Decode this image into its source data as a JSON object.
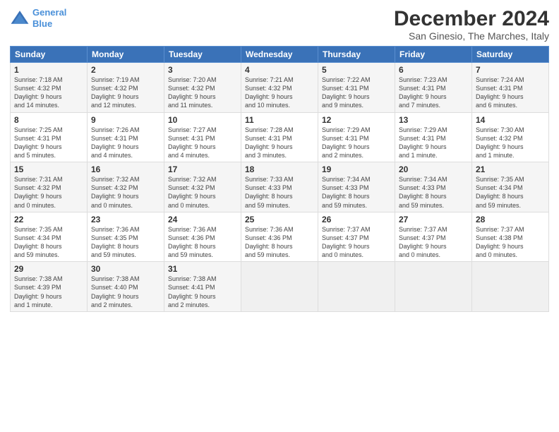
{
  "header": {
    "logo_line1": "General",
    "logo_line2": "Blue",
    "title": "December 2024",
    "subtitle": "San Ginesio, The Marches, Italy"
  },
  "weekdays": [
    "Sunday",
    "Monday",
    "Tuesday",
    "Wednesday",
    "Thursday",
    "Friday",
    "Saturday"
  ],
  "weeks": [
    [
      {
        "day": "1",
        "info": "Sunrise: 7:18 AM\nSunset: 4:32 PM\nDaylight: 9 hours\nand 14 minutes."
      },
      {
        "day": "2",
        "info": "Sunrise: 7:19 AM\nSunset: 4:32 PM\nDaylight: 9 hours\nand 12 minutes."
      },
      {
        "day": "3",
        "info": "Sunrise: 7:20 AM\nSunset: 4:32 PM\nDaylight: 9 hours\nand 11 minutes."
      },
      {
        "day": "4",
        "info": "Sunrise: 7:21 AM\nSunset: 4:32 PM\nDaylight: 9 hours\nand 10 minutes."
      },
      {
        "day": "5",
        "info": "Sunrise: 7:22 AM\nSunset: 4:31 PM\nDaylight: 9 hours\nand 9 minutes."
      },
      {
        "day": "6",
        "info": "Sunrise: 7:23 AM\nSunset: 4:31 PM\nDaylight: 9 hours\nand 7 minutes."
      },
      {
        "day": "7",
        "info": "Sunrise: 7:24 AM\nSunset: 4:31 PM\nDaylight: 9 hours\nand 6 minutes."
      }
    ],
    [
      {
        "day": "8",
        "info": "Sunrise: 7:25 AM\nSunset: 4:31 PM\nDaylight: 9 hours\nand 5 minutes."
      },
      {
        "day": "9",
        "info": "Sunrise: 7:26 AM\nSunset: 4:31 PM\nDaylight: 9 hours\nand 4 minutes."
      },
      {
        "day": "10",
        "info": "Sunrise: 7:27 AM\nSunset: 4:31 PM\nDaylight: 9 hours\nand 4 minutes."
      },
      {
        "day": "11",
        "info": "Sunrise: 7:28 AM\nSunset: 4:31 PM\nDaylight: 9 hours\nand 3 minutes."
      },
      {
        "day": "12",
        "info": "Sunrise: 7:29 AM\nSunset: 4:31 PM\nDaylight: 9 hours\nand 2 minutes."
      },
      {
        "day": "13",
        "info": "Sunrise: 7:29 AM\nSunset: 4:31 PM\nDaylight: 9 hours\nand 1 minute."
      },
      {
        "day": "14",
        "info": "Sunrise: 7:30 AM\nSunset: 4:32 PM\nDaylight: 9 hours\nand 1 minute."
      }
    ],
    [
      {
        "day": "15",
        "info": "Sunrise: 7:31 AM\nSunset: 4:32 PM\nDaylight: 9 hours\nand 0 minutes."
      },
      {
        "day": "16",
        "info": "Sunrise: 7:32 AM\nSunset: 4:32 PM\nDaylight: 9 hours\nand 0 minutes."
      },
      {
        "day": "17",
        "info": "Sunrise: 7:32 AM\nSunset: 4:32 PM\nDaylight: 9 hours\nand 0 minutes."
      },
      {
        "day": "18",
        "info": "Sunrise: 7:33 AM\nSunset: 4:33 PM\nDaylight: 8 hours\nand 59 minutes."
      },
      {
        "day": "19",
        "info": "Sunrise: 7:34 AM\nSunset: 4:33 PM\nDaylight: 8 hours\nand 59 minutes."
      },
      {
        "day": "20",
        "info": "Sunrise: 7:34 AM\nSunset: 4:33 PM\nDaylight: 8 hours\nand 59 minutes."
      },
      {
        "day": "21",
        "info": "Sunrise: 7:35 AM\nSunset: 4:34 PM\nDaylight: 8 hours\nand 59 minutes."
      }
    ],
    [
      {
        "day": "22",
        "info": "Sunrise: 7:35 AM\nSunset: 4:34 PM\nDaylight: 8 hours\nand 59 minutes."
      },
      {
        "day": "23",
        "info": "Sunrise: 7:36 AM\nSunset: 4:35 PM\nDaylight: 8 hours\nand 59 minutes."
      },
      {
        "day": "24",
        "info": "Sunrise: 7:36 AM\nSunset: 4:36 PM\nDaylight: 8 hours\nand 59 minutes."
      },
      {
        "day": "25",
        "info": "Sunrise: 7:36 AM\nSunset: 4:36 PM\nDaylight: 8 hours\nand 59 minutes."
      },
      {
        "day": "26",
        "info": "Sunrise: 7:37 AM\nSunset: 4:37 PM\nDaylight: 9 hours\nand 0 minutes."
      },
      {
        "day": "27",
        "info": "Sunrise: 7:37 AM\nSunset: 4:37 PM\nDaylight: 9 hours\nand 0 minutes."
      },
      {
        "day": "28",
        "info": "Sunrise: 7:37 AM\nSunset: 4:38 PM\nDaylight: 9 hours\nand 0 minutes."
      }
    ],
    [
      {
        "day": "29",
        "info": "Sunrise: 7:38 AM\nSunset: 4:39 PM\nDaylight: 9 hours\nand 1 minute."
      },
      {
        "day": "30",
        "info": "Sunrise: 7:38 AM\nSunset: 4:40 PM\nDaylight: 9 hours\nand 2 minutes."
      },
      {
        "day": "31",
        "info": "Sunrise: 7:38 AM\nSunset: 4:41 PM\nDaylight: 9 hours\nand 2 minutes."
      },
      {
        "day": "",
        "info": ""
      },
      {
        "day": "",
        "info": ""
      },
      {
        "day": "",
        "info": ""
      },
      {
        "day": "",
        "info": ""
      }
    ]
  ]
}
